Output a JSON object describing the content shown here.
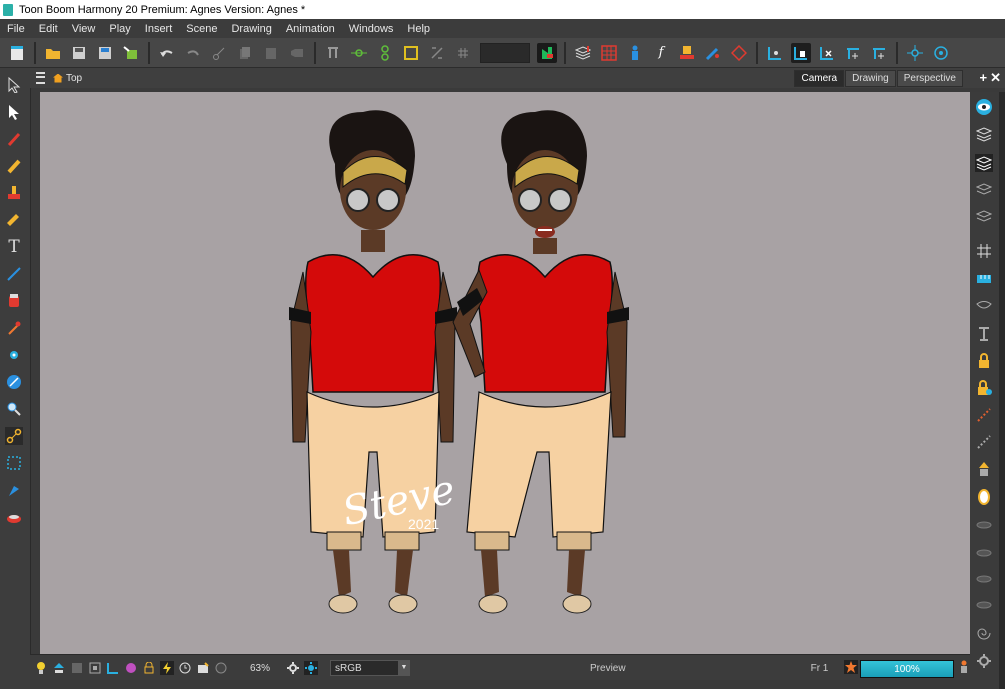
{
  "window": {
    "title": "Toon Boom Harmony 20 Premium: Agnes Version: Agnes *"
  },
  "menu": [
    "File",
    "Edit",
    "View",
    "Play",
    "Insert",
    "Scene",
    "Drawing",
    "Animation",
    "Windows",
    "Help"
  ],
  "view": {
    "breadcrumb": "Top",
    "tabs": [
      "Camera",
      "Drawing",
      "Perspective"
    ],
    "active_tab": "Camera"
  },
  "canvas": {
    "watermark_signature": "Steve",
    "watermark_year": "2021"
  },
  "bottom": {
    "zoom": "63%",
    "color_space": "sRGB",
    "preview_label": "Preview",
    "frame": "Fr 1",
    "progress_label": "100%",
    "progress_fraction": 1.0
  },
  "colors": {
    "accent": "#1fb0c8",
    "canvas_bg": "#a8a2a4",
    "shirt": "#d40a0a",
    "pants": "#f6d1a2",
    "skin": "#5b3a26"
  },
  "icons": {
    "toolbar": [
      "new-scene-icon",
      "open-icon",
      "save-icon",
      "save-all-icon",
      "import-icon",
      "undo-icon",
      "redo-icon",
      "cut-icon",
      "copy-icon",
      "paste-icon",
      "delete-icon",
      "deformer-icon",
      "pivot-icon",
      "peg-icon",
      "transform-box-icon",
      "flip-h-icon",
      "flip-v-icon",
      "drawing-color-icon",
      "layer-stack-icon",
      "grid-icon",
      "character-icon",
      "function-icon",
      "library-icon",
      "pen-icon",
      "onion-skin-icon",
      "camera-view-icon",
      "reset-view-icon",
      "fit-view-icon",
      "center-view-icon",
      "add-view-icon",
      "crosshair-icon",
      "target-icon"
    ],
    "left": [
      "select-icon",
      "transform-icon",
      "brush-icon",
      "pencil-icon",
      "stamp-icon",
      "eraser-icon",
      "text-icon",
      "line-icon",
      "paint-icon",
      "dropper-icon",
      "pivot-dot-icon",
      "ink-icon",
      "zoom-icon",
      "bone-icon",
      "envelope-icon",
      "cutter-icon",
      "bucket-icon"
    ],
    "right": [
      "eye-icon",
      "layers-icon",
      "layers-active-icon",
      "layers-2-icon",
      "layers-3-icon",
      "grid-icon",
      "ruler-icon",
      "mask-icon",
      "anchor-icon",
      "lock-icon",
      "lock-add-icon",
      "dotted-line-icon",
      "dotted-line-2-icon",
      "pin-icon",
      "lamp-icon",
      "disc-icon",
      "disc-2-icon",
      "disc-3-icon",
      "disc-4-icon",
      "spiral-icon",
      "gear-icon"
    ]
  }
}
